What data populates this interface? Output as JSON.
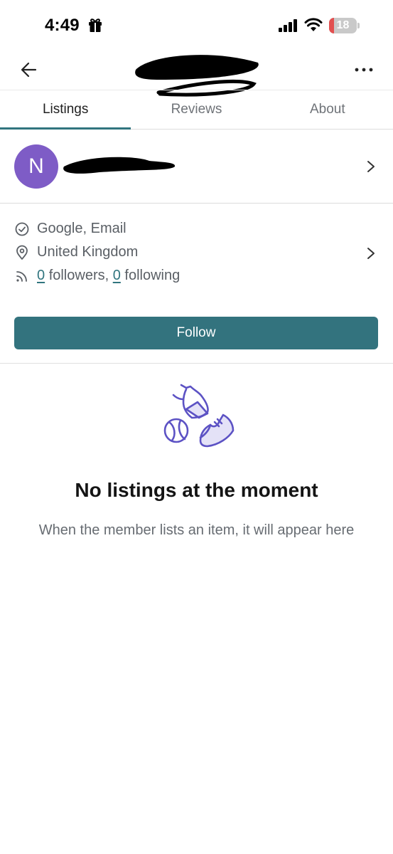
{
  "status_bar": {
    "time": "4:49",
    "battery_level": "18",
    "battery_fraction": 0.18
  },
  "header": {
    "title_redacted": true,
    "back_icon": "arrow-left-icon",
    "menu_icon": "more-horizontal-icon"
  },
  "tabs": [
    {
      "label": "Listings",
      "active": true
    },
    {
      "label": "Reviews",
      "active": false
    },
    {
      "label": "About",
      "active": false
    }
  ],
  "user": {
    "avatar_initial": "N",
    "avatar_color": "#7e5cc6",
    "name_redacted": true
  },
  "info": {
    "verified": "Google, Email",
    "location": "United Kingdom",
    "followers_count": "0",
    "followers_label": "followers,",
    "following_count": "0",
    "following_label": "following"
  },
  "follow_button": {
    "label": "Follow"
  },
  "empty_state": {
    "title": "No listings at the moment",
    "subtitle": "When the member lists an item, it will appear here",
    "icon": "items-illustration-icon"
  },
  "colors": {
    "accent": "#33737e",
    "link": "#31757f",
    "avatar": "#7e5cc6",
    "illustration": "#5c52c4"
  }
}
